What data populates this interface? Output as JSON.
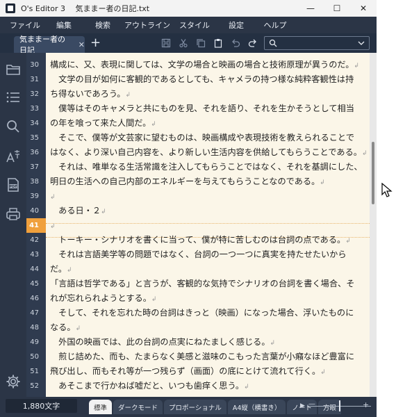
{
  "window": {
    "title": "O's Editor 3　 気ままー者の日記.txt",
    "controls": [
      "—",
      "☐",
      "✕"
    ]
  },
  "menu": [
    "ファイル",
    "編集",
    "検索",
    "アウトライン",
    "スタイル",
    "設定",
    "ヘルプ"
  ],
  "tab": {
    "label": "気ままー者の日記",
    "close": "✕",
    "add": "+"
  },
  "toolbar_icons": [
    "save-icon",
    "cut-icon",
    "copy-icon",
    "paste-icon",
    "undo-icon",
    "redo-icon"
  ],
  "search": {
    "value": "",
    "placeholder": ""
  },
  "sidebar_icons": [
    "folder-icon",
    "outline-list-icon",
    "search-icon",
    "text-style-icon",
    "pdf-icon",
    "print-icon",
    "settings-icon"
  ],
  "current_line": 41,
  "lines": [
    {
      "n": "30",
      "text": "構成に、又、表現に関しては、文学の場合と映画の場合と技術原理が異うのだ。",
      "ret": "↲"
    },
    {
      "n": "31",
      "text": "　文学の目が如何に客観的であるとしても、キャメラの持つ様な純粋客観性は持",
      "ret": ""
    },
    {
      "n": "32",
      "text": "ち得ないであろう。",
      "ret": "↲"
    },
    {
      "n": "33",
      "text": "　僕等はそのキャメラと共にものを見、それを語り、それを生かそうとして相当",
      "ret": ""
    },
    {
      "n": "34",
      "text": "の年を喰って来た人間だ。",
      "ret": "↲"
    },
    {
      "n": "35",
      "text": "　そこで、僕等が文芸家に望むものは、映画構成や表現技術を教えられることで",
      "ret": ""
    },
    {
      "n": "36",
      "text": "はなく、より深い自己内容を、より新しい生活内容を供給してもらうことである。",
      "ret": "↲"
    },
    {
      "n": "37",
      "text": "　それは、唯単なる生活常識を注入してもらうことではなく、それを基調にした、",
      "ret": ""
    },
    {
      "n": "38",
      "text": "明日の生活への自己内部のエネルギーを与えてもらうことなのである。",
      "ret": "↲"
    },
    {
      "n": "39",
      "text": "",
      "ret": "↲"
    },
    {
      "n": "40",
      "text": "　ある日・２",
      "ret": "↲"
    },
    {
      "n": "41",
      "text": "",
      "ret": "↲"
    },
    {
      "n": "42",
      "text": "　トーキー・シナリオを書くに当って、僕が特に苦しむのは台詞の点である。",
      "ret": "↲"
    },
    {
      "n": "43",
      "text": "　それは言語美学等の問題ではなく、台詞の一つ一つに真実を持たせたいから",
      "ret": ""
    },
    {
      "n": "44",
      "text": "だ。",
      "ret": "↲"
    },
    {
      "n": "45",
      "text": "「言語は哲学である」と言うが、客観的な気持でシナリオの台詞を書く場合、そ",
      "ret": ""
    },
    {
      "n": "46",
      "text": "れが忘れられようとする。",
      "ret": "↲"
    },
    {
      "n": "47",
      "text": "　そして、それを忘れた時の台詞はきっと（映画）になった場合、浮いたものに",
      "ret": ""
    },
    {
      "n": "48",
      "text": "なる。",
      "ret": "↲"
    },
    {
      "n": "49",
      "text": "　外国の映画では、此の台詞の点実にねたましく感じる。",
      "ret": "↲"
    },
    {
      "n": "50",
      "text": "　煎じ詰めた、而も、たまらなく美感と滋味のこもった言葉が小癪なほど豊富に",
      "ret": ""
    },
    {
      "n": "51",
      "text": "飛び出し、而もそれ等が一つ残らず（画面）の底にとけて流れて行く。",
      "ret": "↲"
    },
    {
      "n": "52",
      "text": "　あそこまで行かねば嘘だと、いつも歯痒く思う。",
      "ret": "↲"
    }
  ],
  "status": {
    "char_count": "1,880文字",
    "styles": [
      "標準",
      "ダークモード",
      "プロポーショナル",
      "A4縦（横書き）",
      "ノート",
      "方眼"
    ],
    "active_style": 0,
    "scroll_right": "▶",
    "zoom_minus": "—",
    "zoom_plus": "+",
    "zoom_level": 0.5
  }
}
